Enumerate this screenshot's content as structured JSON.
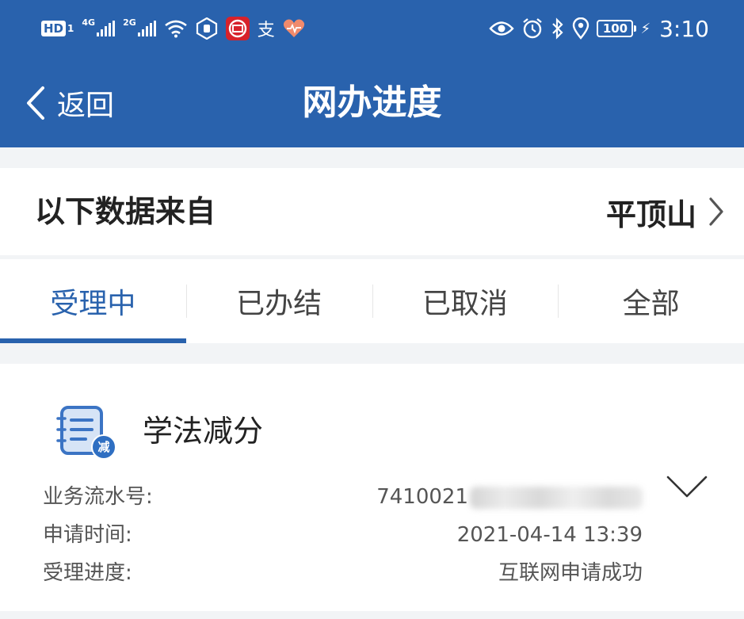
{
  "status_bar": {
    "hd_label": "HD",
    "hd_sim": "1",
    "net1": "4G",
    "net2": "2G",
    "battery": "100",
    "time": "3:10",
    "icons": [
      "hd-icon",
      "signal-4g-icon",
      "signal-2g-icon",
      "wifi-icon",
      "hexagon-hand-icon",
      "citic-logo-icon",
      "alipay-icon",
      "heart-rate-icon",
      "eye-icon",
      "alarm-icon",
      "bluetooth-icon",
      "location-icon",
      "battery-icon",
      "charging-icon"
    ]
  },
  "nav": {
    "back_label": "返回",
    "title": "网办进度",
    "bar_color": "#2962ad"
  },
  "source": {
    "label": "以下数据来自",
    "city": "平顶山"
  },
  "tabs": [
    {
      "label": "受理中",
      "active": true
    },
    {
      "label": "已办结",
      "active": false
    },
    {
      "label": "已取消",
      "active": false
    },
    {
      "label": "全部",
      "active": false
    }
  ],
  "record": {
    "title": "学法减分",
    "icon_badge": "减",
    "fields": [
      {
        "label": "业务流水号:",
        "value": "7410021"
      },
      {
        "label": "申请时间:",
        "value": "2021-04-14 13:39"
      },
      {
        "label": "受理进度:",
        "value": "互联网申请成功"
      }
    ]
  }
}
